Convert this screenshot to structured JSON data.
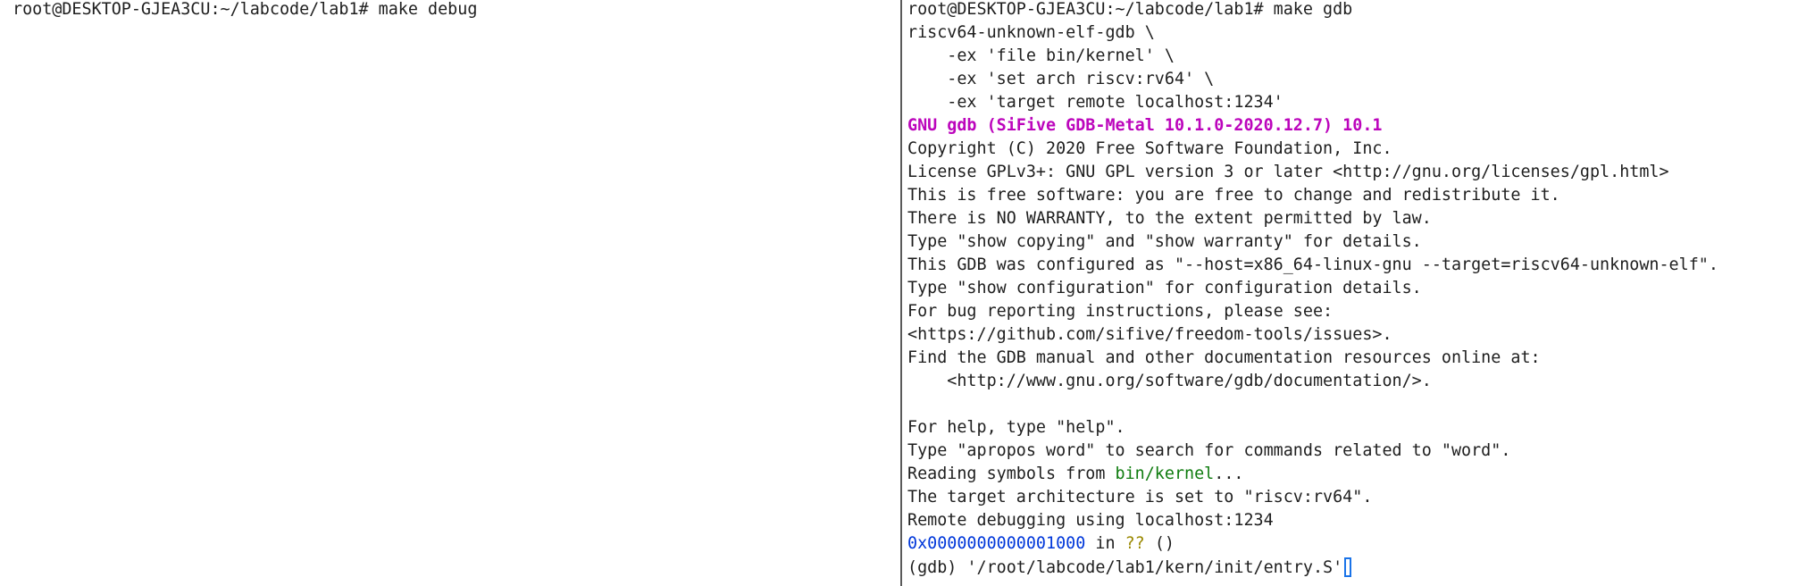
{
  "left_terminal": {
    "prompt": "root@DESKTOP-GJEA3CU:~/labcode/lab1# make debug"
  },
  "right_terminal": {
    "prompt": "root@DESKTOP-GJEA3CU:~/labcode/lab1# make gdb",
    "cmd_lines": [
      "riscv64-unknown-elf-gdb \\",
      "    -ex 'file bin/kernel' \\",
      "    -ex 'set arch riscv:rv64' \\",
      "    -ex 'target remote localhost:1234'"
    ],
    "gdb_banner": "GNU gdb (SiFive GDB-Metal 10.1.0-2020.12.7) 10.1",
    "info_lines": [
      "Copyright (C) 2020 Free Software Foundation, Inc.",
      "License GPLv3+: GNU GPL version 3 or later <http://gnu.org/licenses/gpl.html>",
      "This is free software: you are free to change and redistribute it.",
      "There is NO WARRANTY, to the extent permitted by law.",
      "Type \"show copying\" and \"show warranty\" for details.",
      "This GDB was configured as \"--host=x86_64-linux-gnu --target=riscv64-unknown-elf\".",
      "Type \"show configuration\" for configuration details.",
      "For bug reporting instructions, please see:",
      "<https://github.com/sifive/freedom-tools/issues>.",
      "Find the GDB manual and other documentation resources online at:",
      "    <http://www.gnu.org/software/gdb/documentation/>.",
      "",
      "For help, type \"help\".",
      "Type \"apropos word\" to search for commands related to \"word\"."
    ],
    "reading_prefix": "Reading symbols from ",
    "reading_file": "bin/kernel",
    "reading_suffix": "...",
    "arch_line": "The target architecture is set to \"riscv:rv64\".",
    "remote_line": "Remote debugging using localhost:1234",
    "addr": "0x0000000000001000",
    "addr_in": " in ",
    "addr_func": "??",
    "addr_args": " ()",
    "gdb_prompt": "(gdb) ",
    "gdb_input": "'/root/labcode/lab1/kern/init/entry.S'"
  },
  "colors": {
    "banner": "#bc05bc",
    "filename": "#0f7c0f",
    "address": "#0037da",
    "function": "#9a8800",
    "cursor": "#1a73e8"
  }
}
